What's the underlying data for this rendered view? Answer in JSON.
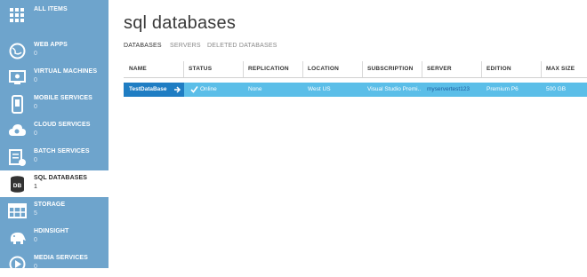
{
  "sidebar": {
    "items": [
      {
        "label": "ALL ITEMS",
        "count": ""
      },
      {
        "label": "WEB APPS",
        "count": "0"
      },
      {
        "label": "VIRTUAL MACHINES",
        "count": "0"
      },
      {
        "label": "MOBILE SERVICES",
        "count": "0"
      },
      {
        "label": "CLOUD SERVICES",
        "count": "0"
      },
      {
        "label": "BATCH SERVICES",
        "count": "0"
      },
      {
        "label": "SQL DATABASES",
        "count": "1"
      },
      {
        "label": "STORAGE",
        "count": "5"
      },
      {
        "label": "HDINSIGHT",
        "count": "0"
      },
      {
        "label": "MEDIA SERVICES",
        "count": "0"
      }
    ]
  },
  "main": {
    "title": "sql databases",
    "tabs": [
      "DATABASES",
      "SERVERS",
      "DELETED DATABASES"
    ],
    "columns": [
      "NAME",
      "STATUS",
      "REPLICATION",
      "LOCATION",
      "SUBSCRIPTION",
      "SERVER",
      "EDITION",
      "MAX SIZE"
    ],
    "rows": [
      {
        "name": "TestDataBase",
        "status": "Online",
        "replication": "None",
        "location": "West US",
        "subscription": "Visual Studio Premi...",
        "server": "myservertest123",
        "edition": "Premium P6",
        "max_size": "500 GB"
      }
    ]
  },
  "colors": {
    "sidebar": "#6ea4cc",
    "row_highlight": "#5bbee8",
    "row_name": "#1f7dc3"
  }
}
